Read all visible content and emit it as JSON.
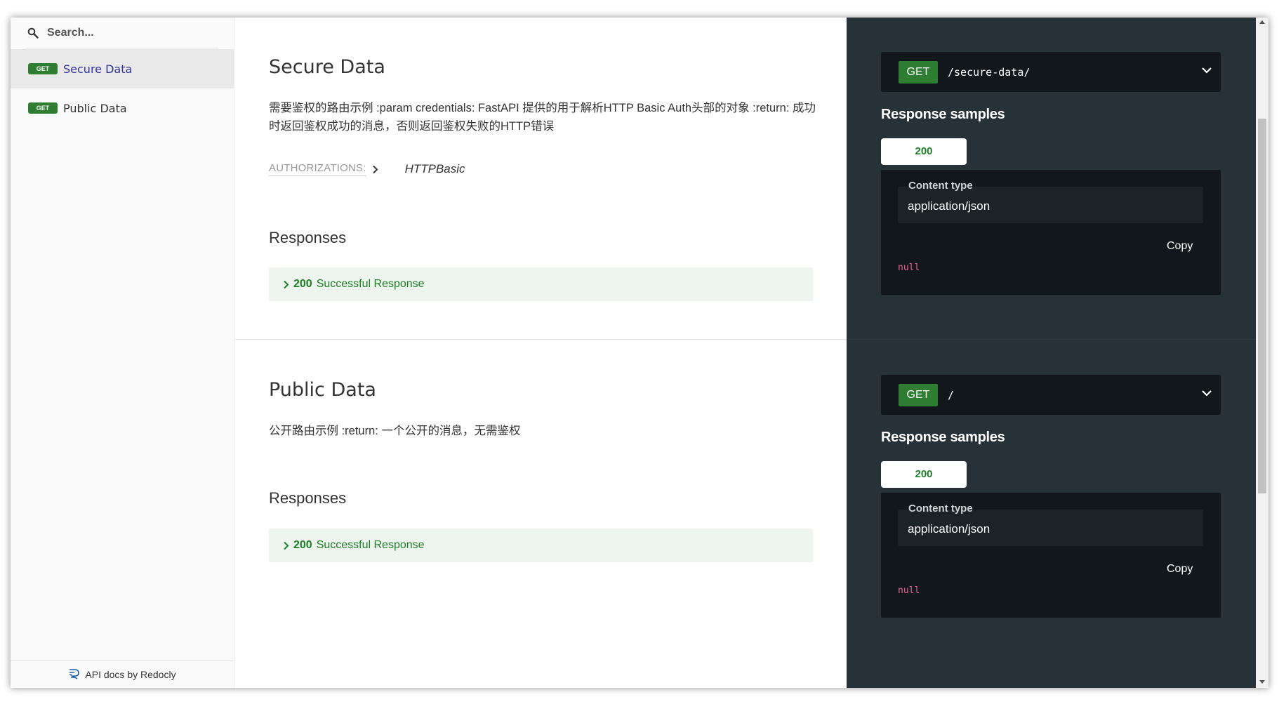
{
  "sidebar": {
    "search_placeholder": "Search...",
    "items": [
      {
        "method": "GET",
        "label": "Secure Data"
      },
      {
        "method": "GET",
        "label": "Public Data"
      }
    ],
    "footer": "API docs by Redocly"
  },
  "operations": [
    {
      "title": "Secure Data",
      "description": "需要鉴权的路由示例 :param credentials: FastAPI 提供的用于解析HTTP Basic Auth头部的对象 :return: 成功时返回鉴权成功的消息，否则返回鉴权失败的HTTP错误",
      "auth_label": "AUTHORIZATIONS:",
      "auth_value": "HTTPBasic",
      "responses_title": "Responses",
      "response": {
        "code": "200",
        "text": "Successful Response"
      },
      "endpoint": {
        "method": "GET",
        "path": "/secure-data/"
      },
      "samples_title": "Response samples",
      "sample_tab": "200",
      "content_type_label": "Content type",
      "content_type": "application/json",
      "copy_label": "Copy",
      "sample_value": "null"
    },
    {
      "title": "Public Data",
      "description": "公开路由示例 :return: 一个公开的消息，无需鉴权",
      "responses_title": "Responses",
      "response": {
        "code": "200",
        "text": "Successful Response"
      },
      "endpoint": {
        "method": "GET",
        "path": "/"
      },
      "samples_title": "Response samples",
      "sample_tab": "200",
      "content_type_label": "Content type",
      "content_type": "application/json",
      "copy_label": "Copy",
      "sample_value": "null"
    }
  ],
  "colors": {
    "get_badge": "#2e7d32",
    "right_panel": "#263238",
    "active_nav_text": "#32329f",
    "success_text": "#1d8127",
    "response_bg": "#eef5ee",
    "null_value": "#f06292"
  }
}
